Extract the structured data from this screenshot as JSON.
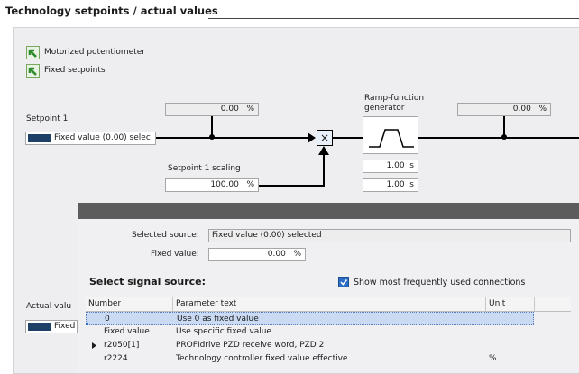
{
  "header": {
    "title": "Technology setpoints / actual values"
  },
  "sources": {
    "motorized_potentiometer": "Motorized potentiometer",
    "fixed_setpoints": "Fixed setpoints"
  },
  "setpoint1": {
    "label": "Setpoint 1",
    "source_value": "Fixed value (0.00) selec",
    "display_value": "0.00",
    "display_unit": "%"
  },
  "scaling": {
    "label": "Setpoint 1 scaling",
    "value": "100.00",
    "unit": "%"
  },
  "rfg": {
    "label_line1": "Ramp-function",
    "label_line2": "generator",
    "ramp_up": "1.00",
    "ramp_up_unit": "s",
    "ramp_down": "1.00",
    "ramp_down_unit": "s",
    "output_value": "0.00",
    "output_unit": "%"
  },
  "multiplier_symbol": "×",
  "actual_value": {
    "label": "Actual valu",
    "source_value": "Fixed"
  },
  "dialog": {
    "selected_source_label": "Selected source:",
    "selected_source_value": "Fixed value (0.00) selected",
    "fixed_value_label": "Fixed value:",
    "fixed_value": "0.00",
    "fixed_value_unit": "%",
    "select_heading": "Select signal source:",
    "show_frequent_label": "Show most frequently used connections",
    "show_frequent_checked": true,
    "columns": [
      "Number",
      "Parameter text",
      "Unit"
    ],
    "rows": [
      {
        "number": "0",
        "text": "Use 0 as fixed value",
        "unit": "",
        "selected": true,
        "expandable": false
      },
      {
        "number": "Fixed value",
        "text": "Use specific fixed value",
        "unit": "",
        "selected": false,
        "expandable": false
      },
      {
        "number": "r2050[1]",
        "text": "PROFIdrive PZD receive word, PZD 2",
        "unit": "",
        "selected": false,
        "expandable": true
      },
      {
        "number": "r2224",
        "text": "Technology controller fixed value effective",
        "unit": "%",
        "selected": false,
        "expandable": false
      }
    ]
  },
  "colors": {
    "accent_green": "#2e8b2e",
    "source_block": "#1e3f66",
    "dialog_header": "#5c5c5c",
    "selected_row": "#c9daf2",
    "checkbox": "#2b6cc4"
  }
}
